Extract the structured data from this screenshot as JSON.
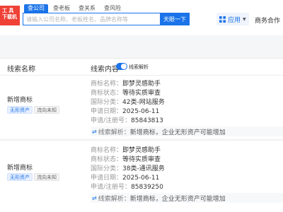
{
  "logo": {
    "line1": "工 具",
    "line2": "下载机"
  },
  "search": {
    "tabs": [
      "查公司",
      "查老板",
      "查关系",
      "查风险"
    ],
    "placeholder": "请输入公司名称、老板姓名、品牌名称等",
    "button": "天眼一下"
  },
  "header": {
    "apps_label": "应用",
    "business_label": "商务合作"
  },
  "table": {
    "col_name": "线索名称",
    "col_content": "线索内容",
    "toggle_label": "线索解析"
  },
  "rows": [
    {
      "title": "新增商标",
      "tags": [
        "无形资产",
        "流向未知"
      ],
      "fields": [
        {
          "k": "商标名称：",
          "v": "即梦灵感助手"
        },
        {
          "k": "商标状态：",
          "v": "等待实质审查"
        },
        {
          "k": "国际分类：",
          "v": "42类-网站服务"
        },
        {
          "k": "申请日期：",
          "v": "2025-06-11"
        },
        {
          "k": "申请/注册号：",
          "v": "85843813"
        }
      ],
      "clue_k": "线索解析：",
      "clue_v": "新增商标，企业无形资产可能增加"
    },
    {
      "title": "新增商标",
      "tags": [
        "无形资产",
        "流向未知"
      ],
      "fields": [
        {
          "k": "商标名称：",
          "v": "即梦灵感助手"
        },
        {
          "k": "商标状态：",
          "v": "等待实质审查"
        },
        {
          "k": "国际分类：",
          "v": "38类-通讯服务"
        },
        {
          "k": "申请日期：",
          "v": "2025-06-11"
        },
        {
          "k": "申请/注册号：",
          "v": "85839250"
        }
      ],
      "clue_k": "线索解析：",
      "clue_v": "新增商标，企业无形资产可能增加"
    }
  ],
  "colors": {
    "accent": "#1a73e8",
    "logo": "#ef4136"
  }
}
